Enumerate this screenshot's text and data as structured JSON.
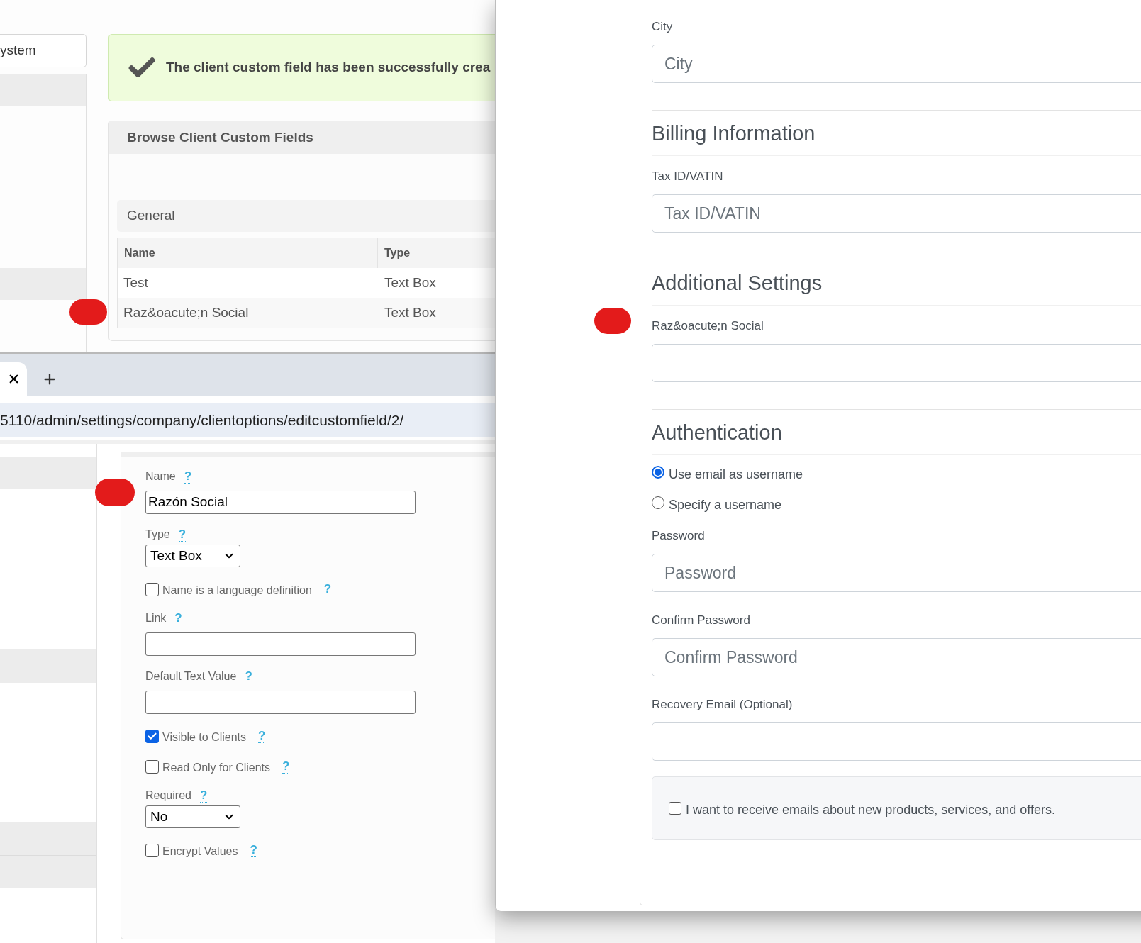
{
  "sidebar": {
    "item": "ystem"
  },
  "alert": {
    "message": "The client custom field has been successfully crea"
  },
  "browse_panel": {
    "title": "Browse Client Custom Fields",
    "group": "General",
    "columns": [
      "Name",
      "Type"
    ],
    "rows": [
      [
        "Test",
        "Text Box"
      ],
      [
        "Raz&oacute;n Social",
        "Text Box"
      ]
    ]
  },
  "browser": {
    "url": "5110/admin/settings/company/clientoptions/editcustomfield/2/"
  },
  "edit_form": {
    "items": [
      {
        "kind": "text",
        "label": "Name",
        "help": "?",
        "value": "Razón Social"
      },
      {
        "kind": "select",
        "label": "Type",
        "help": "?",
        "value": "Text Box"
      },
      {
        "kind": "checkbox",
        "label": "Name is a language definition",
        "help": "?",
        "checked": false
      },
      {
        "kind": "text",
        "label": "Link",
        "help": "?"
      },
      {
        "kind": "text",
        "label": "Default Text Value",
        "help": "?"
      },
      {
        "kind": "checkbox",
        "label": "Visible to Clients",
        "help": "?",
        "checked": true
      },
      {
        "kind": "checkbox",
        "label": "Read Only for Clients",
        "help": "?",
        "checked": false
      },
      {
        "kind": "select",
        "label": "Required",
        "help": "?",
        "value": "No"
      },
      {
        "kind": "checkbox",
        "label": "Encrypt Values",
        "help": "?",
        "checked": false
      }
    ]
  },
  "account_form": {
    "items": [
      {
        "kind": "field",
        "label": "City",
        "placeholder": "City"
      },
      {
        "kind": "heading",
        "text": "Billing Information"
      },
      {
        "kind": "field",
        "label": "Tax ID/VATIN",
        "placeholder": "Tax ID/VATIN"
      },
      {
        "kind": "heading",
        "text": "Additional Settings"
      },
      {
        "kind": "field",
        "label": "Raz&oacute;n Social"
      },
      {
        "kind": "heading",
        "text": "Authentication"
      },
      {
        "kind": "radio",
        "label": "Use email as username",
        "selected": true
      },
      {
        "kind": "radio",
        "label": "Specify a username",
        "selected": false
      },
      {
        "kind": "field",
        "label": "Password",
        "placeholder": "Password"
      },
      {
        "kind": "field",
        "label": "Confirm Password",
        "placeholder": "Confirm Password"
      },
      {
        "kind": "field",
        "label": "Recovery Email (Optional)"
      },
      {
        "kind": "consent",
        "label": "I want to receive emails about new products, services, and offers.",
        "checked": false
      }
    ]
  }
}
